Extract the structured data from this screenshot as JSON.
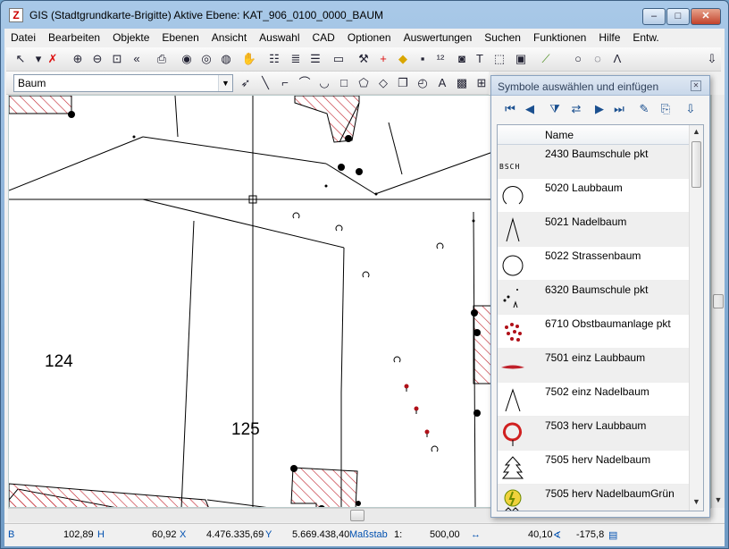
{
  "window": {
    "title": "GIS (Stadtgrundkarte-Brigitte) Aktive Ebene: KAT_906_0100_0000_BAUM",
    "minimize_glyph": "–",
    "maximize_glyph": "□",
    "close_glyph": "✕"
  },
  "menu": [
    "Datei",
    "Bearbeiten",
    "Objekte",
    "Ebenen",
    "Ansicht",
    "Auswahl",
    "CAD",
    "Optionen",
    "Auswertungen",
    "Suchen",
    "Funktionen",
    "Hilfe",
    "Entw."
  ],
  "toolbar1": [
    {
      "name": "select-arrow-icon",
      "glyph": "↖"
    },
    {
      "name": "dropdown-arrow-icon",
      "glyph": "▾"
    },
    {
      "name": "delete-x-icon",
      "glyph": "✗"
    },
    {
      "name": "zoom-in-icon",
      "glyph": "⊕"
    },
    {
      "name": "zoom-out-icon",
      "glyph": "⊖"
    },
    {
      "name": "zoom-window-icon",
      "glyph": "⊡"
    },
    {
      "name": "zoom-previous-icon",
      "glyph": "«"
    },
    {
      "name": "print-icon",
      "glyph": "⎙"
    },
    {
      "name": "globe-icon",
      "glyph": "◉"
    },
    {
      "name": "globe-refresh-icon",
      "glyph": "◎"
    },
    {
      "name": "globe-settings-icon",
      "glyph": "◍"
    },
    {
      "name": "pan-hand-icon",
      "glyph": "✋"
    },
    {
      "name": "layer-list-icon",
      "glyph": "☷"
    },
    {
      "name": "layer-stack-icon",
      "glyph": "≣"
    },
    {
      "name": "layer-properties-icon",
      "glyph": "☰"
    },
    {
      "name": "measure-icon",
      "glyph": "▭"
    },
    {
      "name": "tools-icon",
      "glyph": "⚒"
    },
    {
      "name": "crosshair-icon",
      "glyph": "+"
    },
    {
      "name": "tag-icon",
      "glyph": "◆"
    },
    {
      "name": "node-icon",
      "glyph": "▪"
    },
    {
      "name": "numbering-icon",
      "glyph": "¹²"
    },
    {
      "name": "camera-icon",
      "glyph": "◙"
    },
    {
      "name": "text-tk-icon",
      "glyph": "T"
    },
    {
      "name": "select-frame-icon",
      "glyph": "⬚"
    },
    {
      "name": "window-icon",
      "glyph": "▣"
    },
    {
      "name": "ruler-icon",
      "glyph": "⟋"
    },
    {
      "name": "circle-icon",
      "glyph": "○"
    },
    {
      "name": "open-circle-icon",
      "glyph": "◌"
    },
    {
      "name": "triangle-icon",
      "glyph": "Λ"
    },
    {
      "name": "exit-door-icon",
      "glyph": "⇩"
    }
  ],
  "layer_select": {
    "value": "Baum"
  },
  "toolbar2": [
    {
      "name": "pin-icon",
      "glyph": "➶"
    },
    {
      "name": "line-icon",
      "glyph": "╲"
    },
    {
      "name": "polyline-icon",
      "glyph": "⌐"
    },
    {
      "name": "curve-icon",
      "glyph": "⌒"
    },
    {
      "name": "arc-icon",
      "glyph": "◡"
    },
    {
      "name": "rectangle-icon",
      "glyph": "□"
    },
    {
      "name": "polygon-icon",
      "glyph": "⬠"
    },
    {
      "name": "rhombus-icon",
      "glyph": "◇"
    },
    {
      "name": "stack-icon",
      "glyph": "❐"
    },
    {
      "name": "compass-icon",
      "glyph": "◴"
    },
    {
      "name": "text-icon",
      "glyph": "A"
    },
    {
      "name": "image-icon",
      "glyph": "▩"
    },
    {
      "name": "table-icon",
      "glyph": "⊞"
    }
  ],
  "map": {
    "parcel_labels": [
      "124",
      "125"
    ]
  },
  "status": {
    "mode": "B",
    "val1": "102,89",
    "val1_unit": "H",
    "val2": "60,92",
    "val2_unit": "X",
    "x": "4.476.335,69",
    "x_unit": "Y",
    "y": "5.669.438,40",
    "scale_label": "Maßstab",
    "scale_prefix": "1:",
    "scale": "500,00",
    "width_icon": "↔",
    "angle": "40,10",
    "angle_icon": "∢",
    "angle2": "-175,8",
    "end_icon": "▤"
  },
  "dialog": {
    "title": "Symbole auswählen und einfügen",
    "close_glyph": "✕",
    "toolbar": [
      {
        "name": "first-icon",
        "glyph": "⏮"
      },
      {
        "name": "previous-icon",
        "glyph": "◀"
      },
      {
        "name": "filter-icon",
        "glyph": "⧩"
      },
      {
        "name": "swap-icon",
        "glyph": "⇄"
      },
      {
        "name": "next-icon",
        "glyph": "▶"
      },
      {
        "name": "last-icon",
        "glyph": "⏭"
      },
      {
        "name": "edit-pen-icon",
        "glyph": "✎"
      },
      {
        "name": "insert-icon",
        "glyph": "⎘"
      },
      {
        "name": "exit-icon",
        "glyph": "⇩"
      }
    ],
    "column_header": "Name",
    "symbols": [
      {
        "label": "2430 Baumschule pkt",
        "icon": "bsch-icon",
        "icon_text": "BSCH"
      },
      {
        "label": "5020 Laubbaum",
        "icon": "laubbaum-icon",
        "icon_text": ""
      },
      {
        "label": "5021 Nadelbaum",
        "icon": "nadelbaum-icon",
        "icon_text": ""
      },
      {
        "label": "5022 Strassenbaum",
        "icon": "strassenbaum-icon",
        "icon_text": ""
      },
      {
        "label": "6320 Baumschule pkt",
        "icon": "baumschule-dots-icon",
        "icon_text": ""
      },
      {
        "label": "6710 Obstbaumanlage pkt",
        "icon": "obstbaum-icon",
        "icon_text": ""
      },
      {
        "label": "7501 einz Laubbaum",
        "icon": "einz-laubbaum-icon",
        "icon_text": ""
      },
      {
        "label": "7502 einz Nadelbaum",
        "icon": "einz-nadelbaum-icon",
        "icon_text": ""
      },
      {
        "label": "7503 herv Laubbaum",
        "icon": "herv-laubbaum-icon",
        "icon_text": ""
      },
      {
        "label": "7505 herv Nadelbaum",
        "icon": "herv-nadelbaum-icon",
        "icon_text": ""
      },
      {
        "label": "7505 herv NadelbaumGrün",
        "icon": "herv-nadelbaum-gruen-icon",
        "icon_text": ""
      }
    ]
  },
  "colors": {
    "hatch": "#c0202a",
    "tree_point": "#b01018",
    "accent": "#0050b0"
  }
}
